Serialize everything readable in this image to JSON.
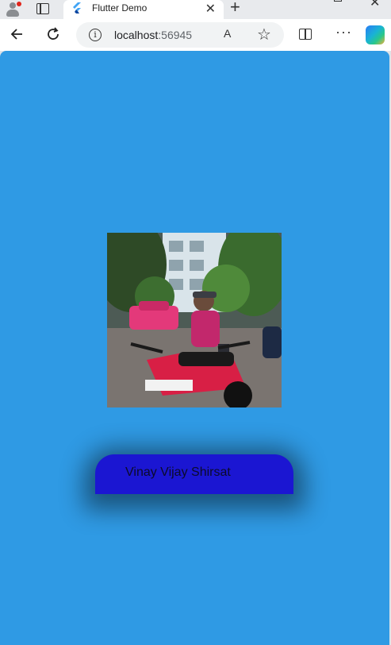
{
  "browser": {
    "tab_title": "Flutter Demo",
    "tab_close": "✕",
    "new_tab": "+",
    "url_host": "localhost",
    "url_port": ":56945",
    "read_aloud": "A",
    "more": "···"
  },
  "app": {
    "background_color": "#2f9ae4",
    "card_color": "#1b16d2",
    "profile_photo_alt": "Profile photo",
    "name": "Vinay Vijay Shirsat"
  }
}
